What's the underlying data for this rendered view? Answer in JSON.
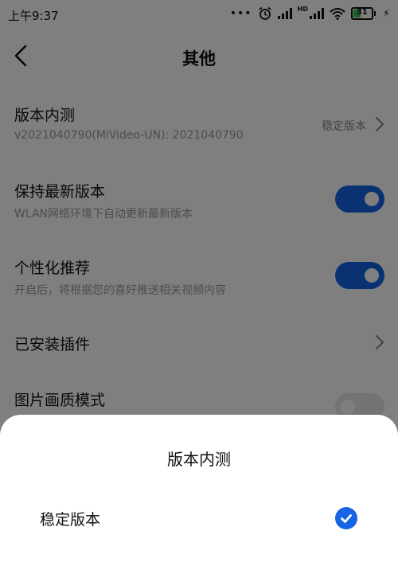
{
  "status_bar": {
    "time": "上午9:37",
    "battery_level": "31"
  },
  "header": {
    "title": "其他"
  },
  "settings": {
    "version": {
      "title": "版本内测",
      "subtitle": "v2021040790(MiVideo-UN): 2021040790",
      "value": "稳定版本"
    },
    "auto_update": {
      "title": "保持最新版本",
      "subtitle": "WLAN网络环境下自动更新最新版本",
      "enabled": true
    },
    "personalized": {
      "title": "个性化推荐",
      "subtitle": "开启后，将根据您的喜好推送相关视频内容",
      "enabled": true
    },
    "plugins": {
      "title": "已安装插件"
    },
    "image_quality": {
      "title": "图片画质模式",
      "enabled": false
    }
  },
  "sheet": {
    "title": "版本内测",
    "options": [
      {
        "label": "稳定版本",
        "selected": true
      }
    ]
  },
  "colors": {
    "accent": "#1565e6",
    "overlay": "rgba(0,0,0,0.5)"
  },
  "icons": [
    "alarm-icon",
    "signal-icon",
    "hd-signal-icon",
    "wifi-icon",
    "battery-icon",
    "charging-icon",
    "back-arrow-icon",
    "chevron-right-icon",
    "check-icon"
  ]
}
